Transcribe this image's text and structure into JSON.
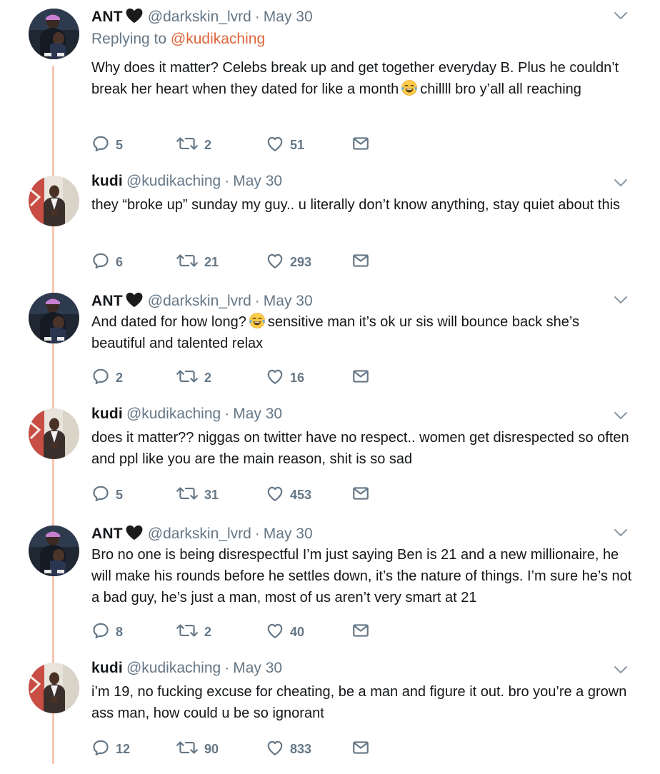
{
  "tweets": [
    {
      "name": "ANT",
      "handle": "@darkskin_lvrd",
      "sep": "·",
      "date": "May 30",
      "reply_prefix": "Replying to ",
      "reply_handle": "@kudikaching",
      "text_a": "Why does it matter? Celebs break up and get together everyday B. Plus he couldn’t break her heart when they dated for like a month",
      "emoji": "face-with-tears-of-joy",
      "text_b": "chillll bro y’all all reaching",
      "replies": "5",
      "retweets": "2",
      "likes": "51"
    },
    {
      "name": "kudi",
      "handle": "@kudikaching",
      "sep": "·",
      "date": "May 30",
      "text_a": "they “broke up” sunday my guy.. u literally don’t know anything, stay quiet about this",
      "replies": "6",
      "retweets": "21",
      "likes": "293"
    },
    {
      "name": "ANT",
      "handle": "@darkskin_lvrd",
      "sep": "·",
      "date": "May 30",
      "text_a": "And dated for how long?",
      "emoji": "face-with-tears-of-joy",
      "text_b": "sensitive man it’s ok ur sis will bounce back she’s beautiful and talented relax",
      "replies": "2",
      "retweets": "2",
      "likes": "16"
    },
    {
      "name": "kudi",
      "handle": "@kudikaching",
      "sep": "·",
      "date": "May 30",
      "text_a": "does it matter?? niggas on twitter have no respect.. women get disrespected so often and ppl like you are the main reason, shit is so sad",
      "replies": "5",
      "retweets": "31",
      "likes": "453"
    },
    {
      "name": "ANT",
      "handle": "@darkskin_lvrd",
      "sep": "·",
      "date": "May 30",
      "text_a": "Bro no one is being disrespectful I’m just saying Ben is 21 and a new millionaire, he will make his rounds before he settles down, it’s the nature of things. I’m sure he’s not a bad guy, he’s just a man, most of us aren’t very smart at 21",
      "replies": "8",
      "retweets": "2",
      "likes": "40"
    },
    {
      "name": "kudi",
      "handle": "@kudikaching",
      "sep": "·",
      "date": "May 30",
      "text_a": "i’m 19, no fucking excuse for cheating, be a man and figure it out. bro you’re a grown ass man, how could u be so ignorant",
      "replies": "12",
      "retweets": "90",
      "likes": "833"
    }
  ],
  "icons": {
    "name_badge": "black-heart-icon",
    "menu": "chevron-down-icon",
    "reply": "reply-icon",
    "retweet": "retweet-icon",
    "like": "like-icon",
    "dm": "direct-message-icon"
  },
  "colors": {
    "thread_line": "#f9c5b3",
    "link": "#e0663b",
    "meta": "#657786",
    "text": "#14171a"
  }
}
